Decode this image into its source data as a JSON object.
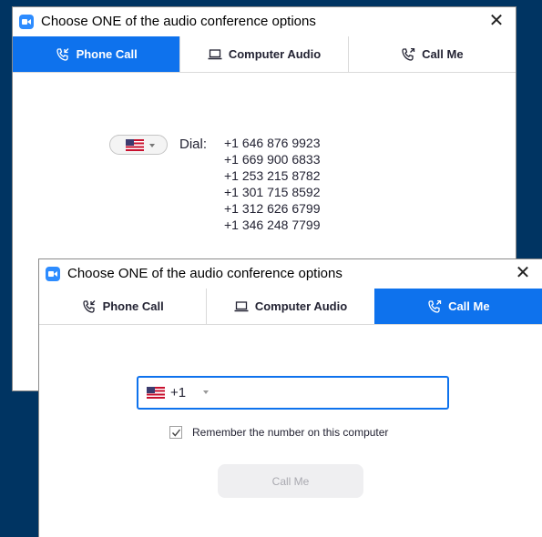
{
  "dialog_back": {
    "title": "Choose ONE of the audio conference options",
    "tabs": [
      {
        "label": "Phone Call",
        "active": true
      },
      {
        "label": "Computer Audio",
        "active": false
      },
      {
        "label": "Call Me",
        "active": false
      }
    ],
    "dial_label": "Dial:",
    "numbers": [
      "+1 646 876 9923",
      "+1 669 900 6833",
      "+1 253 215 8782",
      "+1 301 715 8592",
      "+1 312 626 6799",
      "+1 346 248 7799"
    ]
  },
  "dialog_front": {
    "title": "Choose ONE of the audio conference options",
    "tabs": [
      {
        "label": "Phone Call",
        "active": false
      },
      {
        "label": "Computer Audio",
        "active": false
      },
      {
        "label": "Call Me",
        "active": true
      }
    ],
    "country_code": "+1",
    "remember_label": "Remember the number on this computer",
    "remember_checked": true,
    "call_button_label": "Call Me"
  },
  "icons": {
    "app": "zoom-app-icon",
    "close": "close-icon",
    "phone": "phone-call-icon",
    "computer": "laptop-icon",
    "callme": "phone-callback-icon",
    "flag": "us-flag-icon",
    "dropdown": "caret-down-icon",
    "check": "checkmark-icon"
  },
  "colors": {
    "background": "#003462",
    "active_tab": "#0e72ed",
    "app_icon": "#2d8cff",
    "disabled_button": "#efeff1"
  }
}
